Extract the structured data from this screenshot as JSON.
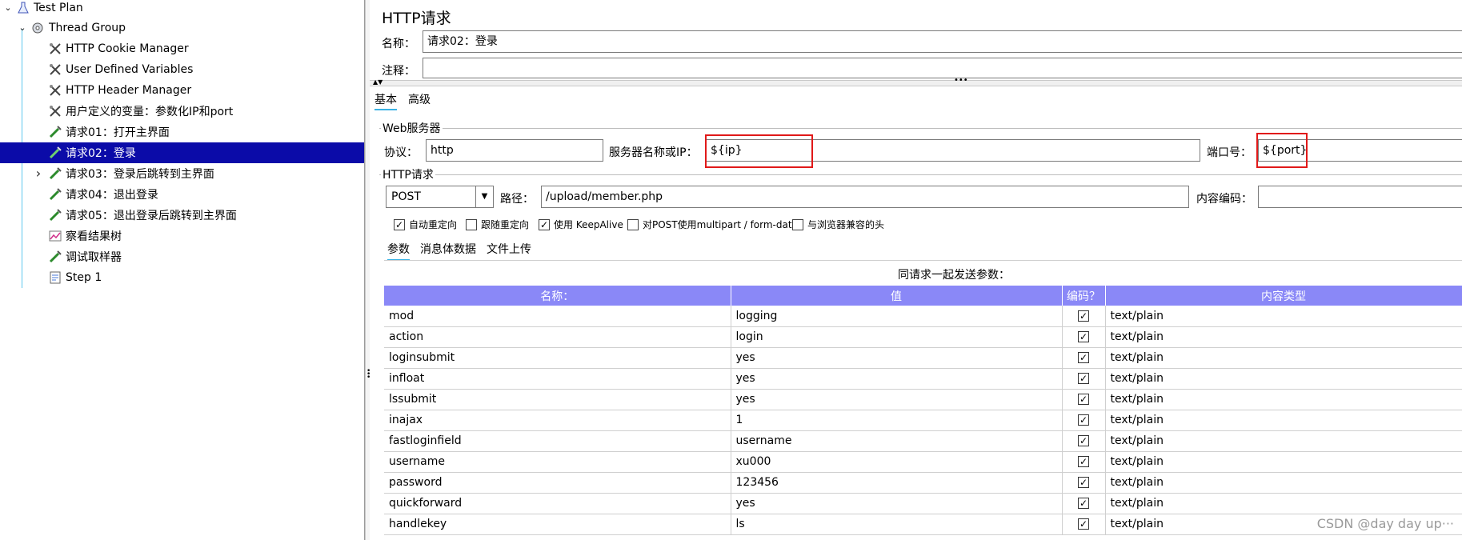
{
  "tree": {
    "items": [
      {
        "label": "Test Plan",
        "icon": "flask-icon",
        "arrow": "⌄"
      },
      {
        "label": "Thread Group",
        "icon": "gear-icon",
        "arrow": "⌄"
      },
      {
        "label": "HTTP Cookie Manager",
        "icon": "wrench-icon"
      },
      {
        "label": "User Defined Variables",
        "icon": "wrench-icon"
      },
      {
        "label": "HTTP Header Manager",
        "icon": "wrench-icon"
      },
      {
        "label": "用户定义的变量：参数化IP和port",
        "icon": "wrench-icon"
      },
      {
        "label": "请求01：打开主界面",
        "icon": "pipette-icon"
      },
      {
        "label": "请求02：登录",
        "icon": "pipette-icon",
        "selected": true
      },
      {
        "label": "请求03：登录后跳转到主界面",
        "icon": "pipette-icon",
        "arrow": "›"
      },
      {
        "label": "请求04：退出登录",
        "icon": "pipette-icon"
      },
      {
        "label": "请求05：退出登录后跳转到主界面",
        "icon": "pipette-icon"
      },
      {
        "label": "察看结果树",
        "icon": "chart-icon"
      },
      {
        "label": "调试取样器",
        "icon": "pipette-icon"
      },
      {
        "label": "Step 1",
        "icon": "document-icon"
      }
    ]
  },
  "panel": {
    "title": "HTTP请求",
    "name_label": "名称：",
    "name_value": "请求02：登录",
    "comment_label": "注释：",
    "comment_value": "",
    "tabs": [
      "基本",
      "高级"
    ],
    "web_server": {
      "group_title": "Web服务器",
      "protocol_label": "协议：",
      "protocol_value": "http",
      "server_label": "服务器名称或IP：",
      "server_value": "${ip}",
      "port_label": "端口号：",
      "port_value": "${port}"
    },
    "http_request": {
      "group_title": "HTTP请求",
      "method": "POST",
      "path_label": "路径：",
      "path_value": "/upload/member.php",
      "encoding_label": "内容编码："
    },
    "options": [
      {
        "label": "自动重定向",
        "checked": true
      },
      {
        "label": "跟随重定向",
        "checked": false
      },
      {
        "label": "使用 KeepAlive",
        "checked": true
      },
      {
        "label": "对POST使用multipart / form-data",
        "checked": false
      },
      {
        "label": "与浏览器兼容的头",
        "checked": false
      }
    ],
    "subtabs": [
      "参数",
      "消息体数据",
      "文件上传"
    ],
    "params_caption": "同请求一起发送参数：",
    "columns": [
      "名称：",
      "值",
      "编码？",
      "内容类型"
    ],
    "rows": [
      {
        "name": "mod",
        "value": "logging",
        "encode": true,
        "type": "text/plain"
      },
      {
        "name": "action",
        "value": "login",
        "encode": true,
        "type": "text/plain"
      },
      {
        "name": "loginsubmit",
        "value": "yes",
        "encode": true,
        "type": "text/plain"
      },
      {
        "name": "infloat",
        "value": "yes",
        "encode": true,
        "type": "text/plain"
      },
      {
        "name": "lssubmit",
        "value": "yes",
        "encode": true,
        "type": "text/plain"
      },
      {
        "name": "inajax",
        "value": "1",
        "encode": true,
        "type": "text/plain"
      },
      {
        "name": "fastloginfield",
        "value": "username",
        "encode": true,
        "type": "text/plain"
      },
      {
        "name": "username",
        "value": "xu000",
        "encode": true,
        "type": "text/plain"
      },
      {
        "name": "password",
        "value": "123456",
        "encode": true,
        "type": "text/plain"
      },
      {
        "name": "quickforward",
        "value": "yes",
        "encode": true,
        "type": "text/plain"
      },
      {
        "name": "handlekey",
        "value": "ls",
        "encode": true,
        "type": "text/plain"
      }
    ]
  },
  "watermark": "CSDN @day day up···",
  "colors": {
    "selection": "#0b0ba8",
    "table_header": "#8a88f7",
    "highlight_box": "#e11919",
    "tab_underline": "#39b2e4"
  }
}
